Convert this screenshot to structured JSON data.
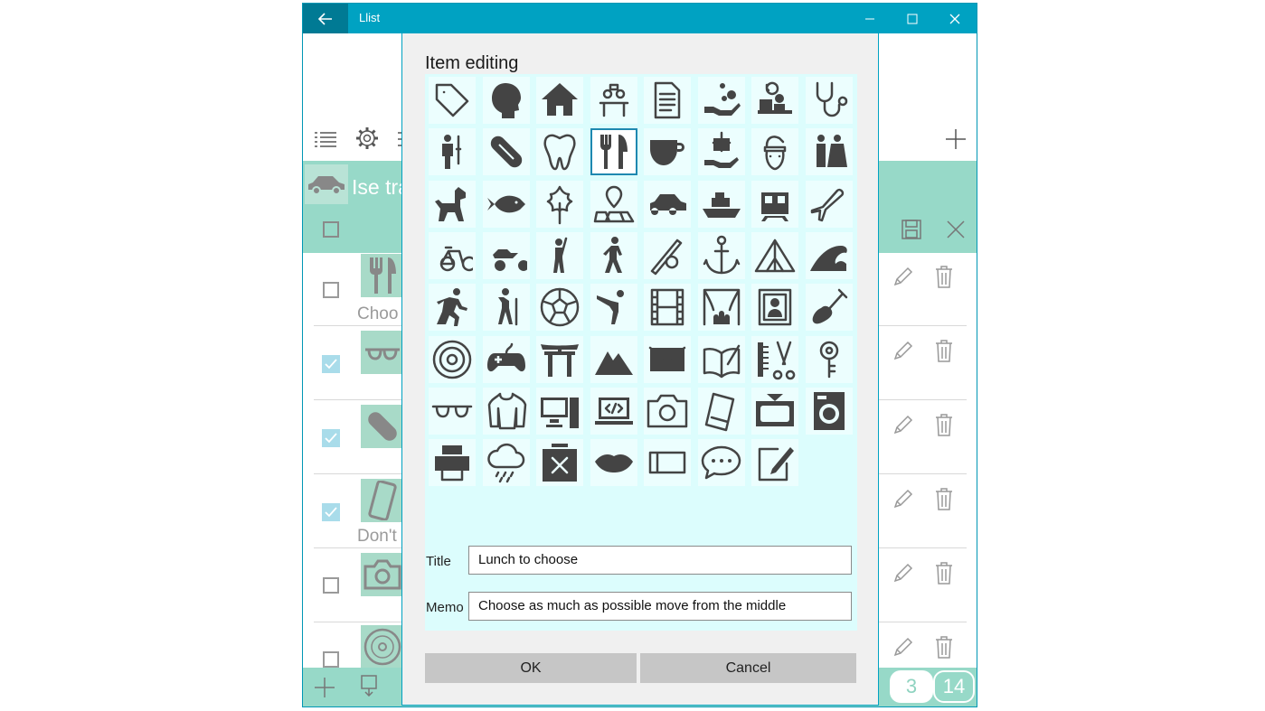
{
  "app": {
    "title": "Llist",
    "colors": {
      "accent": "#00a2c2",
      "accent_dark": "#007a94",
      "band": "#97d9c8",
      "icon": "#4a4a4a"
    }
  },
  "window_controls": [
    "minimize-icon",
    "maximize-icon",
    "close-icon"
  ],
  "toolbar": [
    "list-icon",
    "gear-icon",
    "more-icon",
    "plus-icon"
  ],
  "list": {
    "header_text": "Ise tra",
    "rows": [
      {
        "checked": false,
        "icon": "fork-knife-icon",
        "caption": "Choo"
      },
      {
        "checked": true,
        "icon": "glasses-icon",
        "caption": ""
      },
      {
        "checked": true,
        "icon": "pill-icon",
        "caption": ""
      },
      {
        "checked": true,
        "icon": "tablet-icon",
        "caption": "Don't"
      },
      {
        "checked": false,
        "icon": "camera-icon",
        "caption": ""
      },
      {
        "checked": false,
        "icon": "cd-icon",
        "caption": ""
      }
    ],
    "counters": {
      "checked": "3",
      "total": "14"
    }
  },
  "dialog": {
    "title": "Item editing",
    "icons": [
      "tag-icon",
      "head-icon",
      "house-icon",
      "meeting-icon",
      "document-icon",
      "hand-bubbles-icon",
      "desk-clock-icon",
      "stethoscope-icon",
      "person-iv-icon",
      "pill-icon",
      "tooth-icon",
      "fork-knife-icon",
      "cup-icon",
      "gift-hand-icon",
      "santa-icon",
      "couple-icon",
      "dog-icon",
      "fish-icon",
      "leaf-icon",
      "map-pin-icon",
      "car-icon",
      "ship-icon",
      "train-icon",
      "airplane-icon",
      "bicycle-icon",
      "motorcycle-icon",
      "golf-icon",
      "walking-icon",
      "baseball-icon",
      "anchor-icon",
      "tent-icon",
      "wave-icon",
      "running-icon",
      "hiking-icon",
      "soccer-ball-icon",
      "yoga-icon",
      "film-icon",
      "theater-icon",
      "portrait-icon",
      "guitar-icon",
      "cd-icon",
      "gamepad-icon",
      "torii-icon",
      "mountain-icon",
      "envelope-icon",
      "book-pen-icon",
      "comb-scissors-icon",
      "key-icon",
      "glasses-icon",
      "sweater-icon",
      "desktop-icon",
      "laptop-code-icon",
      "camera-icon",
      "tablet-icon",
      "tv-icon",
      "washing-machine-icon",
      "printer-icon",
      "rain-cloud-icon",
      "trash-bin-icon",
      "lips-icon",
      "ticket-icon",
      "chat-icon",
      "edit-note-icon"
    ],
    "selected_index": 11,
    "title_label": "Title",
    "title_value": "Lunch to choose",
    "memo_label": "Memo",
    "memo_value": "Choose as much as possible move from the middle",
    "ok_label": "OK",
    "cancel_label": "Cancel"
  }
}
